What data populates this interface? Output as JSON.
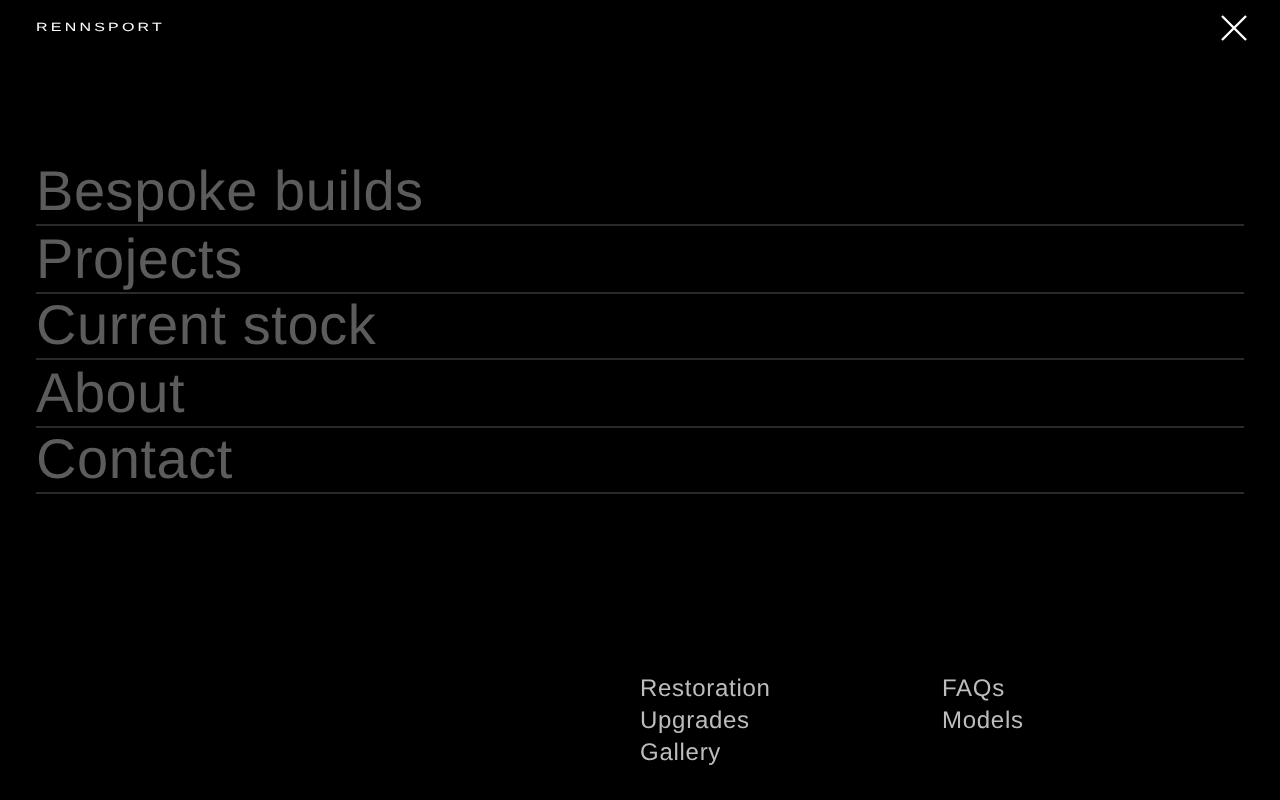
{
  "header": {
    "logo": "RENNSPORT"
  },
  "menu": [
    {
      "label": "Bespoke builds"
    },
    {
      "label": "Projects"
    },
    {
      "label": "Current stock"
    },
    {
      "label": "About"
    },
    {
      "label": "Contact"
    }
  ],
  "footer_links": [
    [
      "Restoration",
      "Upgrades",
      "Gallery"
    ],
    [
      "FAQs",
      "Models"
    ]
  ]
}
